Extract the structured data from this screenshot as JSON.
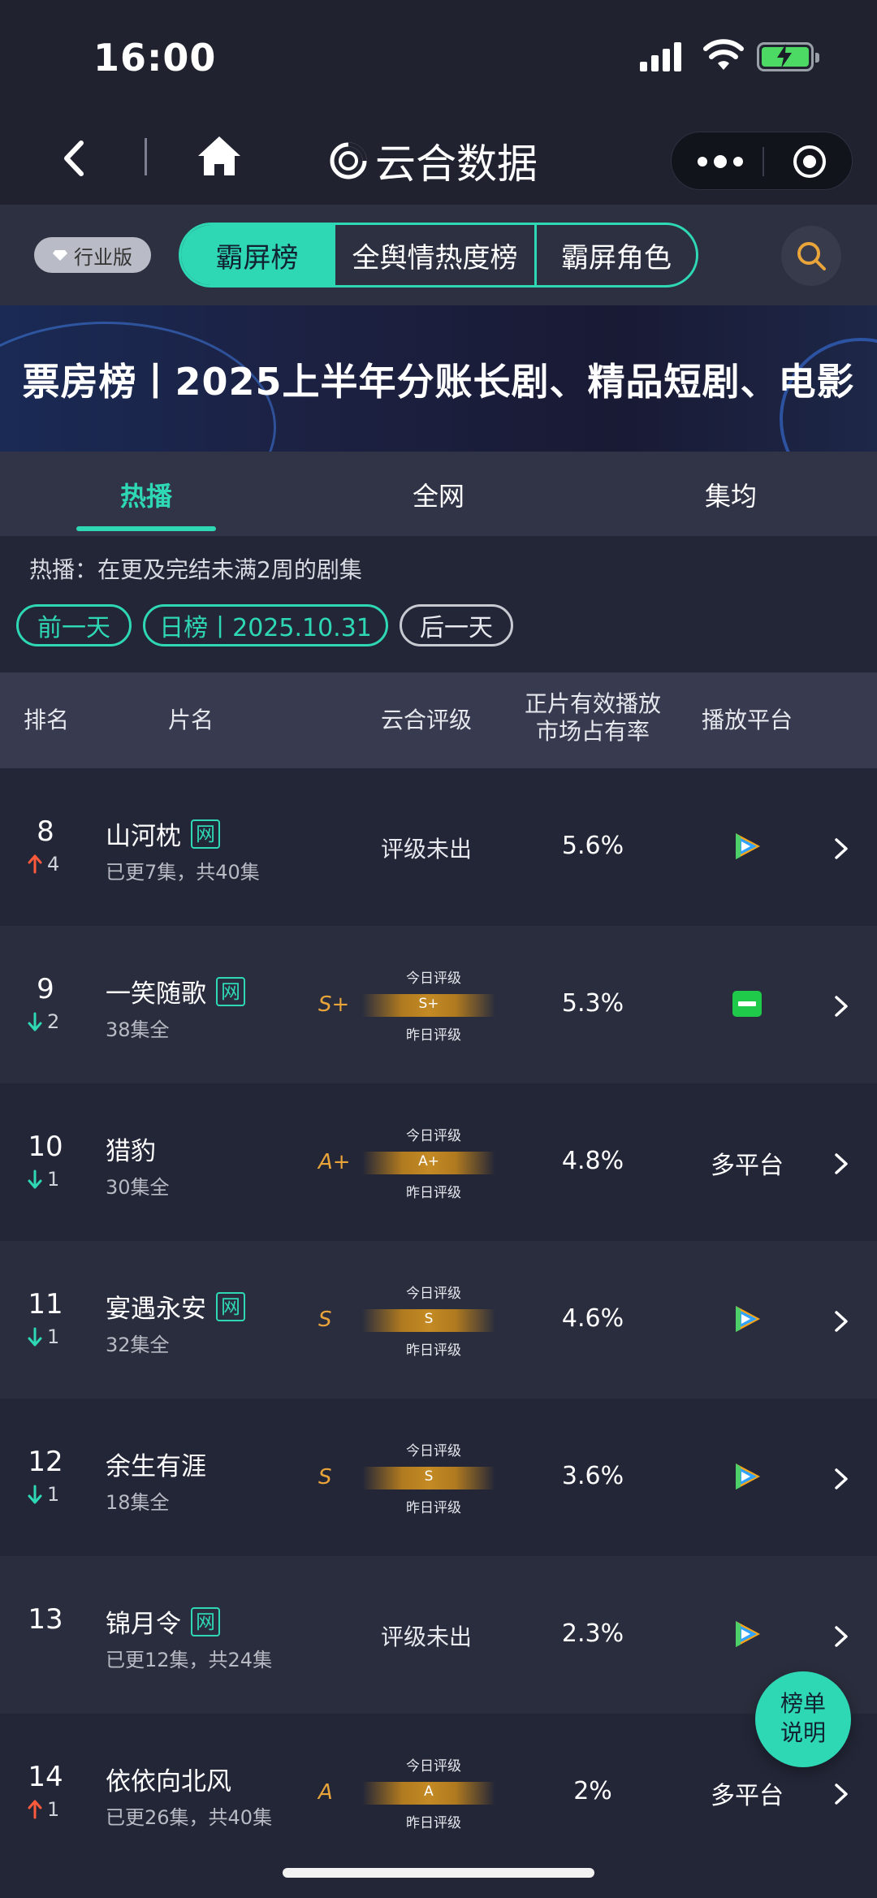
{
  "status": {
    "time": "16:00"
  },
  "nav": {
    "title": "云合数据"
  },
  "topbar": {
    "industry": "行业版",
    "segments": [
      "霸屏榜",
      "全舆情热度榜",
      "霸屏角色"
    ],
    "active_segment": 0
  },
  "banner": {
    "text": "票房榜丨2025上半年分账长剧、精品短剧、电影"
  },
  "subtabs": [
    "热播",
    "全网",
    "集均"
  ],
  "note": "热播：在更及完结未满2周的剧集",
  "date_nav": {
    "prev": "前一天",
    "current": "日榜丨2025.10.31",
    "next": "后一天"
  },
  "table_header": {
    "rank": "排名",
    "name": "片名",
    "grade": "云合评级",
    "share_line1": "正片有效播放",
    "share_line2": "市场占有率",
    "platform": "播放平台"
  },
  "grade_labels": {
    "today": "今日评级",
    "yesterday": "昨日评级"
  },
  "rows": [
    {
      "rank": "8",
      "dir": "up",
      "change": "4",
      "name": "山河枕",
      "net": "网",
      "eps": "已更7集，共40集",
      "grade": "",
      "grade_text": "评级未出",
      "share": "5.6%",
      "platform": "tencent-video-icon",
      "platform_text": ""
    },
    {
      "rank": "9",
      "dir": "down",
      "change": "2",
      "name": "一笑随歌",
      "net": "网",
      "eps": "38集全",
      "grade": "S+",
      "grade_text": "",
      "share": "5.3%",
      "platform": "iqiyi-icon",
      "platform_text": ""
    },
    {
      "rank": "10",
      "dir": "down",
      "change": "1",
      "name": "猎豹",
      "net": "",
      "eps": "30集全",
      "grade": "A+",
      "grade_text": "",
      "share": "4.8%",
      "platform": "",
      "platform_text": "多平台"
    },
    {
      "rank": "11",
      "dir": "down",
      "change": "1",
      "name": "宴遇永安",
      "net": "网",
      "eps": "32集全",
      "grade": "S",
      "grade_text": "",
      "share": "4.6%",
      "platform": "tencent-video-icon",
      "platform_text": ""
    },
    {
      "rank": "12",
      "dir": "down",
      "change": "1",
      "name": "余生有涯",
      "net": "",
      "eps": "18集全",
      "grade": "S",
      "grade_text": "",
      "share": "3.6%",
      "platform": "tencent-video-icon",
      "platform_text": ""
    },
    {
      "rank": "13",
      "dir": "",
      "change": "",
      "name": "锦月令",
      "net": "网",
      "eps": "已更12集，共24集",
      "grade": "",
      "grade_text": "评级未出",
      "share": "2.3%",
      "platform": "tencent-video-icon",
      "platform_text": ""
    },
    {
      "rank": "14",
      "dir": "up",
      "change": "1",
      "name": "依依向北风",
      "net": "",
      "eps": "已更26集，共40集",
      "grade": "A",
      "grade_text": "",
      "share": "2%",
      "platform": "",
      "platform_text": "多平台"
    }
  ],
  "fab": {
    "line1": "榜单",
    "line2": "说明"
  },
  "colors": {
    "accent": "#2fd8b4",
    "up": "#ff5a3c",
    "down": "#2fd8b4",
    "grade": "#e9a43a",
    "background": "#232637"
  }
}
